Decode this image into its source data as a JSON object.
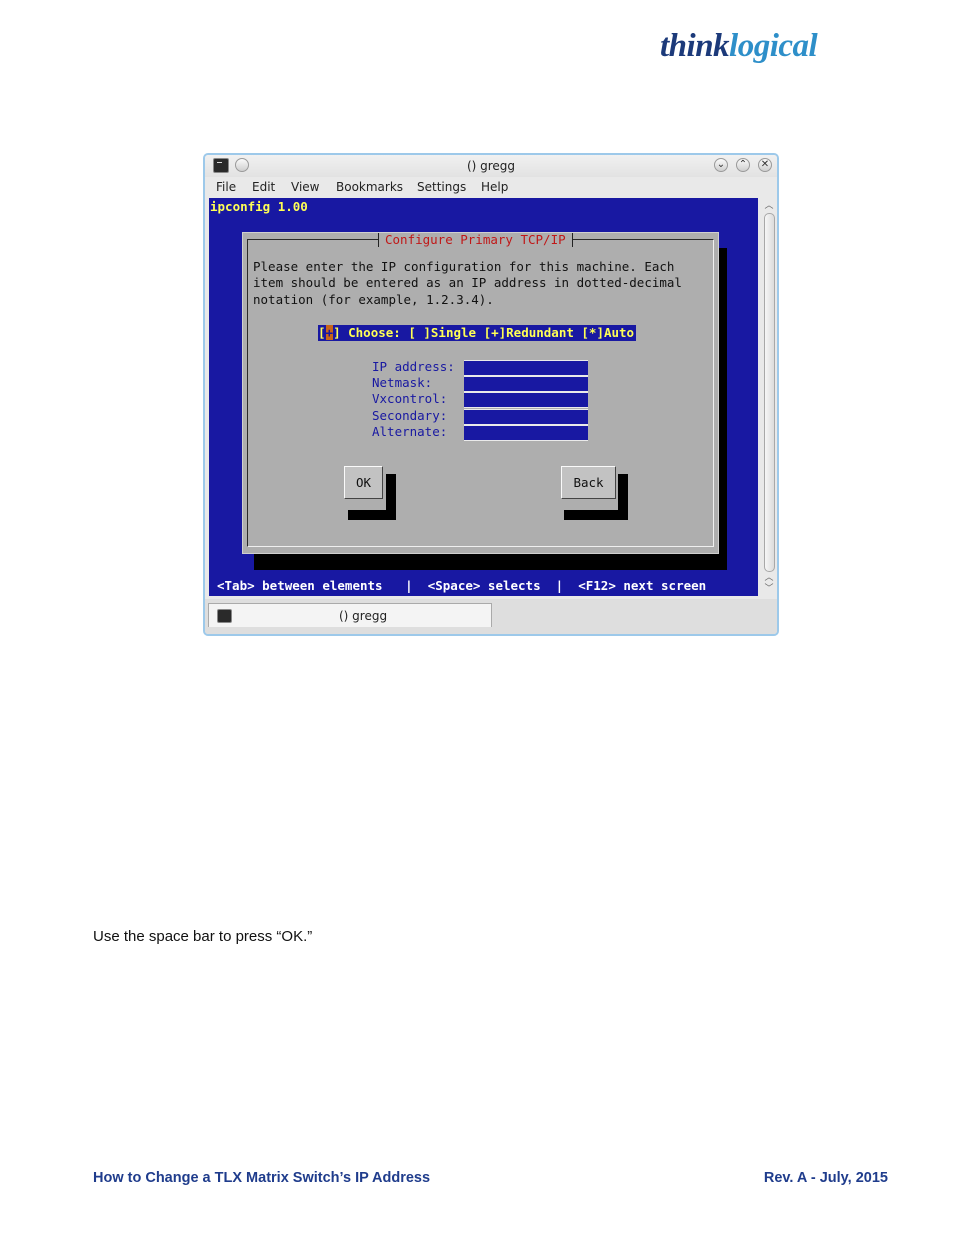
{
  "logo": {
    "part1": "think",
    "part2": "logical"
  },
  "window": {
    "title": "() gregg",
    "menu": [
      "File",
      "Edit",
      "View",
      "Bookmarks",
      "Settings",
      "Help"
    ],
    "buttons": {
      "minimize": "⌄",
      "maximize": "⌃",
      "close": "✕"
    },
    "tab_label": "() gregg"
  },
  "terminal": {
    "header": "ipconfig 1.00",
    "dialog_title": "Configure Primary TCP/IP",
    "instructions": "Please enter the IP configuration for this machine. Each\nitem should be entered as an IP address in dotted-decimal\nnotation (for example, 1.2.3.4).",
    "choose": {
      "open_bracket": "[",
      "cursor": "+",
      "rest": "] Choose: [ ]Single [+]Redundant [*]Auto"
    },
    "fields": [
      {
        "label": "IP address:",
        "value": ""
      },
      {
        "label": "Netmask:",
        "value": ""
      },
      {
        "label": "Vxcontrol:",
        "value": ""
      },
      {
        "label": "Secondary:",
        "value": ""
      },
      {
        "label": "Alternate:",
        "value": ""
      }
    ],
    "ok_label": "OK",
    "back_label": "Back",
    "status_line": "<Tab> between elements   |  <Space> selects  |  <F12> next screen"
  },
  "caption": "Use the space bar to press “OK.”",
  "footer": {
    "left": "How to Change a TLX Matrix Switch’s IP Address",
    "right": "Rev. A - July, 2015"
  },
  "colors": {
    "terminal_bg": "#1818a2",
    "dialog_bg": "#aeaeae",
    "title_red": "#c01818",
    "highlight_yellow": "#ffff55",
    "footer_blue": "#1f3c8c"
  }
}
